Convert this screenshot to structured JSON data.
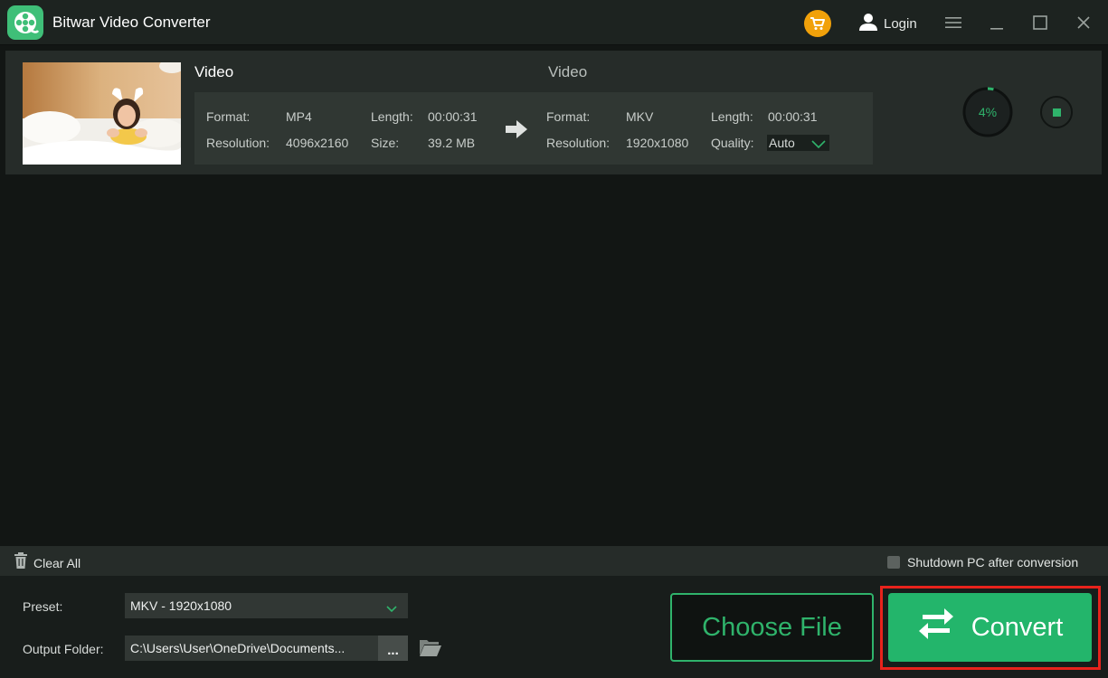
{
  "app": {
    "title": "Bitwar Video Converter",
    "login_label": "Login"
  },
  "colors": {
    "accent": "#2fb36b",
    "cart": "#f1a10a",
    "highlight_frame": "#e8231c"
  },
  "file": {
    "source": {
      "title": "Video",
      "format_label": "Format:",
      "format": "MP4",
      "length_label": "Length:",
      "length": "00:00:31",
      "resolution_label": "Resolution:",
      "resolution": "4096x2160",
      "size_label": "Size:",
      "size": "39.2 MB"
    },
    "target": {
      "title": "Video",
      "format_label": "Format:",
      "format": "MKV",
      "length_label": "Length:",
      "length": "00:00:31",
      "resolution_label": "Resolution:",
      "resolution": "1920x1080",
      "quality_label": "Quality:",
      "quality": "Auto"
    },
    "progress_text": "4%",
    "progress_fraction": 0.04
  },
  "toolbar": {
    "clear_all": "Clear All",
    "shutdown_label": "Shutdown PC after conversion"
  },
  "settings": {
    "preset_label": "Preset:",
    "preset_value": "MKV - 1920x1080",
    "output_label": "Output Folder:",
    "output_value": "C:\\Users\\User\\OneDrive\\Documents...",
    "browse_label": "..."
  },
  "actions": {
    "choose_file": "Choose File",
    "convert": "Convert"
  },
  "icons": {
    "logo": "film-reel-icon",
    "cart": "cart-icon",
    "user": "user-icon",
    "menu": "menu-icon",
    "minimize": "minimize-icon",
    "maximize": "maximize-icon",
    "close": "close-icon",
    "arrow": "arrow-right-icon",
    "trash": "trash-icon",
    "folder": "folder-open-icon",
    "convert": "convert-arrows-icon",
    "stop": "stop-icon"
  }
}
